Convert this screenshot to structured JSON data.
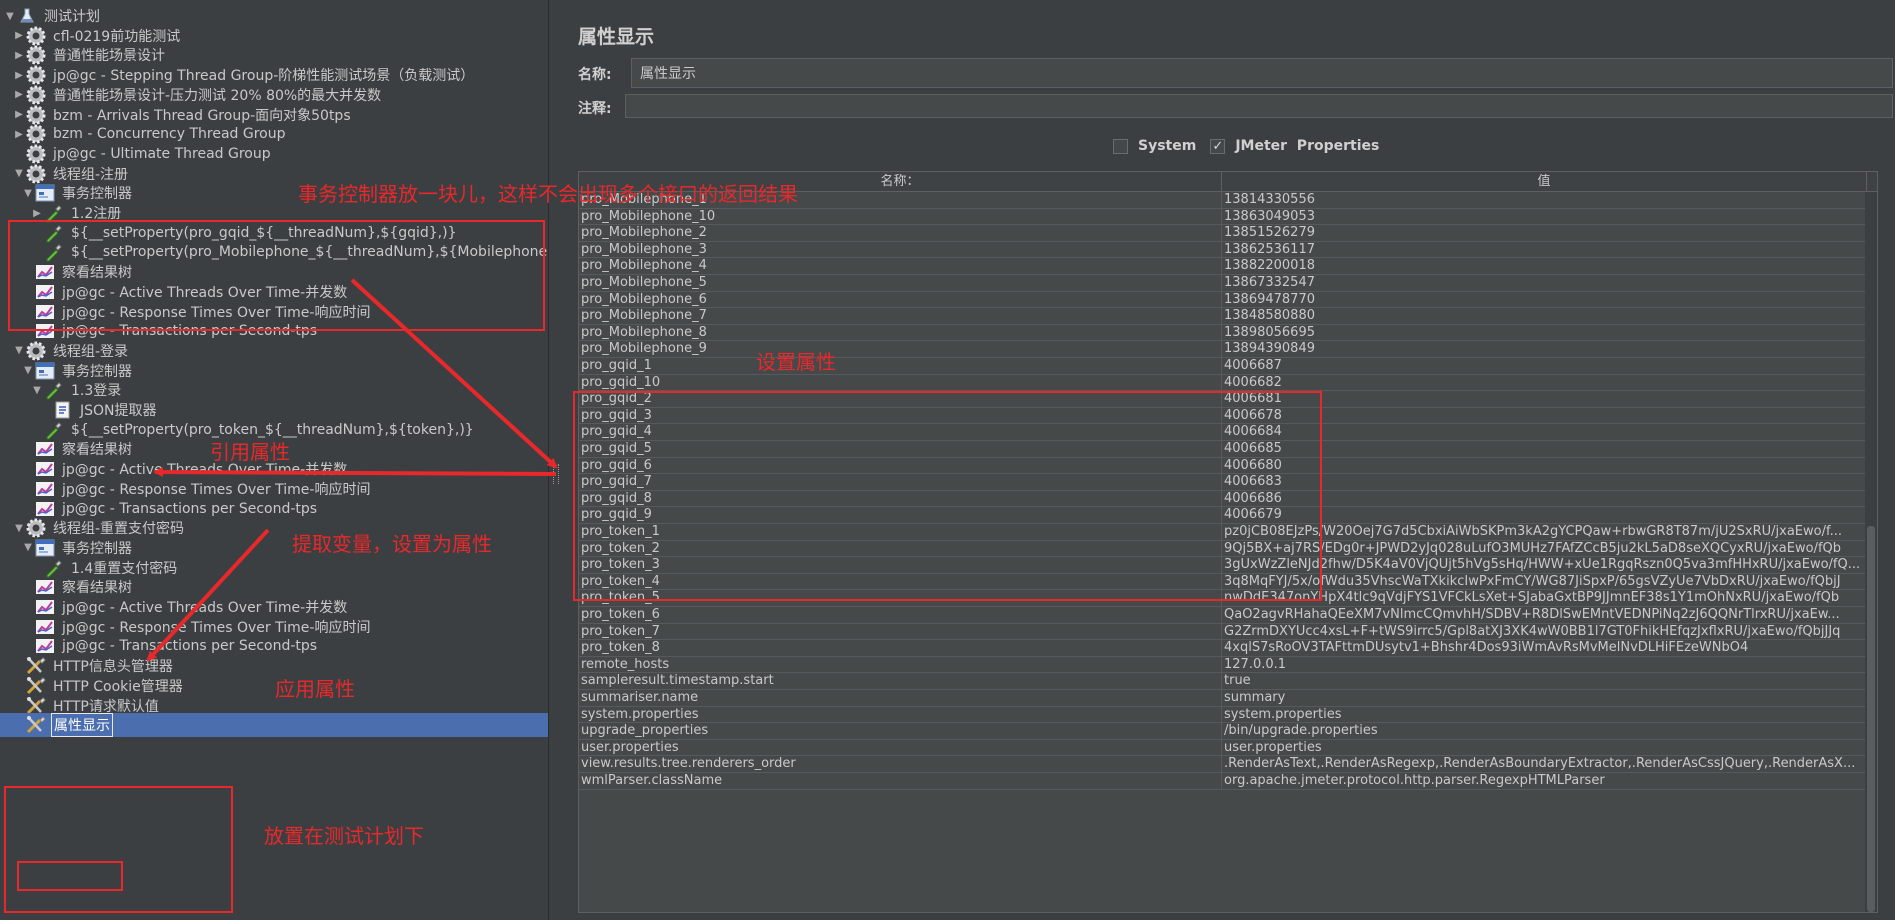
{
  "tree": [
    {
      "label": "测试计划",
      "indent": 0,
      "twisty": "down",
      "icon": "flask-icon"
    },
    {
      "label": "cfl-0219前功能测试",
      "indent": 1,
      "twisty": "right",
      "icon": "thread-group-gear-icon"
    },
    {
      "label": "普通性能场景设计",
      "indent": 1,
      "twisty": "right",
      "icon": "thread-group-gear-icon"
    },
    {
      "label": "jp@gc - Stepping Thread Group-阶梯性能测试场景（负载测试）",
      "indent": 1,
      "twisty": "right",
      "icon": "thread-group-gear-icon"
    },
    {
      "label": "普通性能场景设计-压力测试 20% 80%的最大并发数",
      "indent": 1,
      "twisty": "right",
      "icon": "thread-group-gear-icon"
    },
    {
      "label": "bzm - Arrivals Thread Group-面向对象50tps",
      "indent": 1,
      "twisty": "right",
      "icon": "thread-group-gear-icon"
    },
    {
      "label": "bzm - Concurrency Thread Group",
      "indent": 1,
      "twisty": "right",
      "icon": "thread-group-gear-icon"
    },
    {
      "label": "jp@gc - Ultimate Thread Group",
      "indent": 1,
      "twisty": "none",
      "icon": "thread-group-gear-icon"
    },
    {
      "label": "线程组-注册",
      "indent": 1,
      "twisty": "down",
      "icon": "thread-group-gear-icon"
    },
    {
      "label": "事务控制器",
      "indent": 2,
      "twisty": "down",
      "icon": "transaction-controller-icon"
    },
    {
      "label": "1.2注册",
      "indent": 3,
      "twisty": "right",
      "icon": "sampler-pipette-icon"
    },
    {
      "label": "${__setProperty(pro_gqid_${__threadNum},${gqid},)}",
      "indent": 3,
      "twisty": "none",
      "icon": "sampler-pipette-icon"
    },
    {
      "label": "${__setProperty(pro_Mobilephone_${__threadNum},${Mobilephone},)}",
      "indent": 3,
      "twisty": "none",
      "icon": "sampler-pipette-icon"
    },
    {
      "label": "察看结果树",
      "indent": 2,
      "twisty": "none",
      "icon": "listener-chart-icon"
    },
    {
      "label": "jp@gc - Active Threads Over Time-并发数",
      "indent": 2,
      "twisty": "none",
      "icon": "listener-chart-icon"
    },
    {
      "label": "jp@gc - Response Times Over Time-响应时间",
      "indent": 2,
      "twisty": "none",
      "icon": "listener-chart-icon"
    },
    {
      "label": "jp@gc - Transactions per Second-tps",
      "indent": 2,
      "twisty": "none",
      "icon": "listener-chart-icon"
    },
    {
      "label": "线程组-登录",
      "indent": 1,
      "twisty": "down",
      "icon": "thread-group-gear-icon"
    },
    {
      "label": "事务控制器",
      "indent": 2,
      "twisty": "down",
      "icon": "transaction-controller-icon"
    },
    {
      "label": "1.3登录",
      "indent": 3,
      "twisty": "down",
      "icon": "sampler-pipette-icon"
    },
    {
      "label": "JSON提取器",
      "indent": 4,
      "twisty": "none",
      "icon": "json-extractor-icon"
    },
    {
      "label": "${__setProperty(pro_token_${__threadNum},${token},)}",
      "indent": 3,
      "twisty": "none",
      "icon": "sampler-pipette-icon"
    },
    {
      "label": "察看结果树",
      "indent": 2,
      "twisty": "none",
      "icon": "listener-chart-icon"
    },
    {
      "label": "jp@gc - Active Threads Over Time-并发数",
      "indent": 2,
      "twisty": "none",
      "icon": "listener-chart-icon"
    },
    {
      "label": "jp@gc - Response Times Over Time-响应时间",
      "indent": 2,
      "twisty": "none",
      "icon": "listener-chart-icon"
    },
    {
      "label": "jp@gc - Transactions per Second-tps",
      "indent": 2,
      "twisty": "none",
      "icon": "listener-chart-icon"
    },
    {
      "label": "线程组-重置支付密码",
      "indent": 1,
      "twisty": "down",
      "icon": "thread-group-gear-icon"
    },
    {
      "label": "事务控制器",
      "indent": 2,
      "twisty": "down",
      "icon": "transaction-controller-icon"
    },
    {
      "label": "1.4重置支付密码",
      "indent": 3,
      "twisty": "none",
      "icon": "sampler-pipette-icon"
    },
    {
      "label": "察看结果树",
      "indent": 2,
      "twisty": "none",
      "icon": "listener-chart-icon"
    },
    {
      "label": "jp@gc - Active Threads Over Time-并发数",
      "indent": 2,
      "twisty": "none",
      "icon": "listener-chart-icon"
    },
    {
      "label": "jp@gc - Response Times Over Time-响应时间",
      "indent": 2,
      "twisty": "none",
      "icon": "listener-chart-icon"
    },
    {
      "label": "jp@gc - Transactions per Second-tps",
      "indent": 2,
      "twisty": "none",
      "icon": "listener-chart-icon"
    },
    {
      "label": "HTTP信息头管理器",
      "indent": 1,
      "twisty": "none",
      "icon": "config-wrench-icon"
    },
    {
      "label": "HTTP Cookie管理器",
      "indent": 1,
      "twisty": "none",
      "icon": "config-wrench-icon"
    },
    {
      "label": "HTTP请求默认值",
      "indent": 1,
      "twisty": "none",
      "icon": "config-wrench-icon"
    },
    {
      "label": "属性显示",
      "indent": 1,
      "twisty": "none",
      "icon": "config-wrench-icon",
      "selected": true
    }
  ],
  "panel": {
    "title": "属性显示",
    "name_label": "名称:",
    "name_value": "属性显示",
    "comment_label": "注释:",
    "comment_value": "",
    "system_label": "System",
    "system_checked": false,
    "jmeter_label": "JMeter  Properties",
    "jmeter_checked": true
  },
  "table": {
    "headers": [
      "名称：",
      "值"
    ],
    "rows": [
      [
        "pro_Mobilephone_1",
        "13814330556"
      ],
      [
        "pro_Mobilephone_10",
        "13863049053"
      ],
      [
        "pro_Mobilephone_2",
        "13851526279"
      ],
      [
        "pro_Mobilephone_3",
        "13862536117"
      ],
      [
        "pro_Mobilephone_4",
        "13882200018"
      ],
      [
        "pro_Mobilephone_5",
        "13867332547"
      ],
      [
        "pro_Mobilephone_6",
        "13869478770"
      ],
      [
        "pro_Mobilephone_7",
        "13848580880"
      ],
      [
        "pro_Mobilephone_8",
        "13898056695"
      ],
      [
        "pro_Mobilephone_9",
        "13894390849"
      ],
      [
        "pro_gqid_1",
        "4006687"
      ],
      [
        "pro_gqid_10",
        "4006682"
      ],
      [
        "pro_gqid_2",
        "4006681"
      ],
      [
        "pro_gqid_3",
        "4006678"
      ],
      [
        "pro_gqid_4",
        "4006684"
      ],
      [
        "pro_gqid_5",
        "4006685"
      ],
      [
        "pro_gqid_6",
        "4006680"
      ],
      [
        "pro_gqid_7",
        "4006683"
      ],
      [
        "pro_gqid_8",
        "4006686"
      ],
      [
        "pro_gqid_9",
        "4006679"
      ],
      [
        "pro_token_1",
        "pz0jCB08EJzPs/W20Oej7G7d5CbxiAiWbSKPm3kA2gYCPQaw+rbwGR8T87m/jU2SxRU/jxaEwo/f..."
      ],
      [
        "pro_token_2",
        "9Qj5BX+aj7RS/EDg0r+JPWD2yJq028uLufO3MUHz7FAfZCcB5ju2kL5aD8seXQCyxRU/jxaEwo/fQb"
      ],
      [
        "pro_token_3",
        "3gUxWzZleNJd2fhw/D5K4aV0VjQUjt5hVg5sHq/HWW+xUe1RgqRszn0Q5va3mfHHxRU/jxaEwo/fQ..."
      ],
      [
        "pro_token_4",
        "3q8MqFYJ/5x/ofWdu35VhscWaTXkikcIwPxFmCY/WG87JiSpxP/65gsVZyUe7VbDxRU/jxaEwo/fQbjJ"
      ],
      [
        "pro_token_5",
        "nwDdE347onYHpX4tlc9qVdjFYS1VFCkLsXet+SJabaGxtBP9JJmnEF38s1Y1mOhNxRU/jxaEwo/fQb"
      ],
      [
        "pro_token_6",
        "QaO2agvRHahaQEeXM7vNlmcCQmvhH/SDBV+R8DlSwEMntVEDNPiNq2zJ6QQNrTlrxRU/jxaEw..."
      ],
      [
        "pro_token_7",
        "G2ZrmDXYUcc4xsL+F+tWS9irrc5/Gpl8atXJ3XK4wW0BB1l7GT0FhikHEfqzJxflxRU/jxaEwo/fQbjJJq"
      ],
      [
        "pro_token_8",
        "4xqlS7sRoOV3TAFttmDUsytv1+Bhshr4Dos93iWmAvRsMvMelNvDLHiFEzeWNbO4"
      ],
      [
        "remote_hosts",
        "127.0.0.1"
      ],
      [
        "sampleresult.timestamp.start",
        "true"
      ],
      [
        "summariser.name",
        "summary"
      ],
      [
        "system.properties",
        "system.properties"
      ],
      [
        "upgrade_properties",
        "/bin/upgrade.properties"
      ],
      [
        "user.properties",
        "user.properties"
      ],
      [
        "view.results.tree.renderers_order",
        ".RenderAsText,.RenderAsRegexp,.RenderAsBoundaryExtractor,.RenderAsCssJQuery,.RenderAsX..."
      ],
      [
        "wmlParser.className",
        "org.apache.jmeter.protocol.http.parser.RegexpHTMLParser"
      ]
    ]
  },
  "annotations": {
    "note_transaction": "事务控制器放一块儿，这样不会出现多个接口的返回结果",
    "note_set_property": "设置属性",
    "note_reference": "引用属性",
    "note_extract": "提取变量，设置为属性",
    "note_apply": "应用属性",
    "note_place": "放置在测试计划下",
    "color": "#e8282a"
  }
}
